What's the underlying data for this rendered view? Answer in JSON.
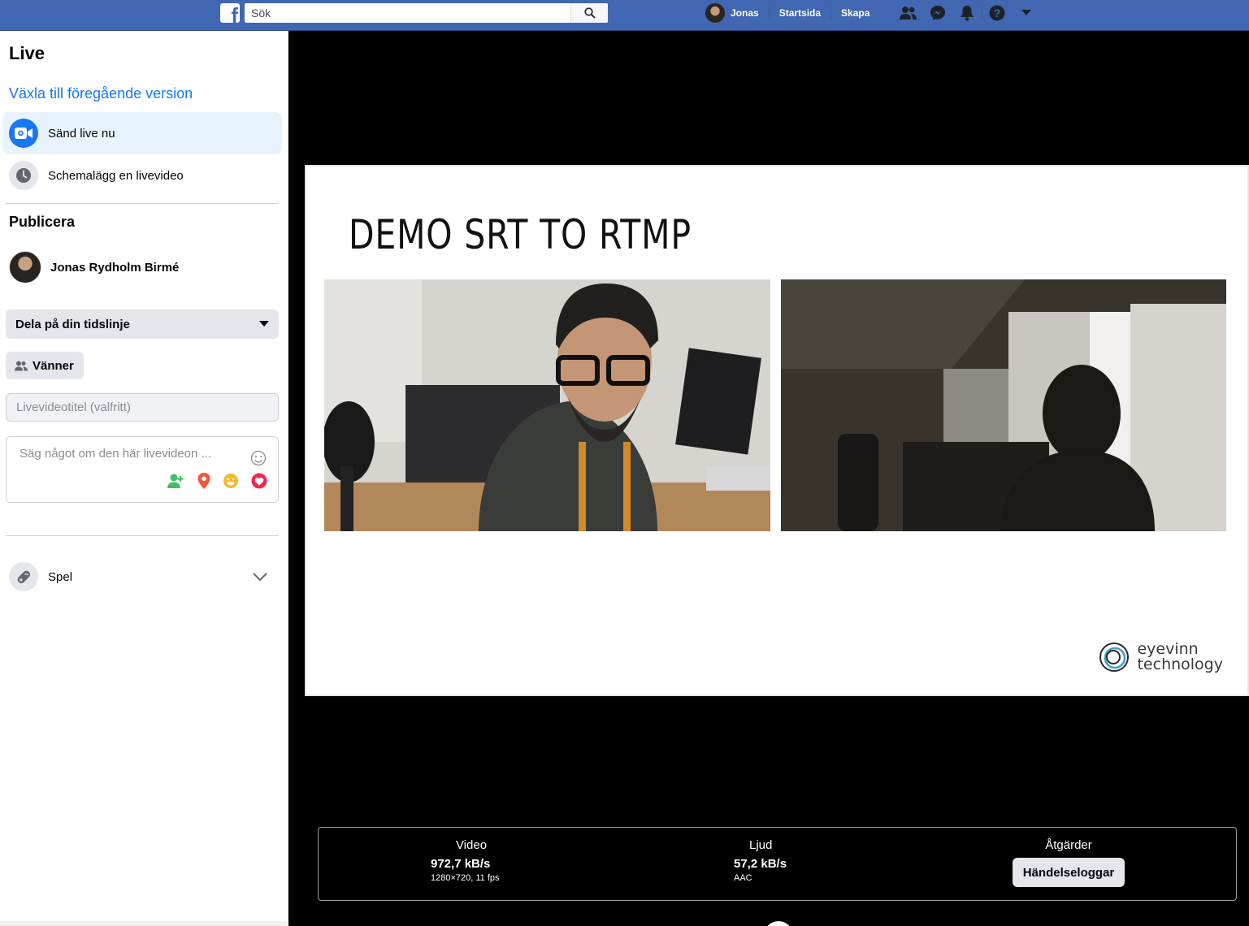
{
  "topbar": {
    "logo": "f",
    "search_placeholder": "Sök",
    "user": "Jonas",
    "links": [
      "Startsida",
      "Skapa"
    ],
    "icons": [
      "friends-icon",
      "messenger-icon",
      "notifications-icon",
      "help-icon",
      "dropdown-icon"
    ]
  },
  "sidebar": {
    "title": "Live",
    "switch_link": "Växla till föregående version",
    "items": [
      {
        "label": "Sänd live nu",
        "icon": "video-camera-icon"
      },
      {
        "label": "Schemalägg en livevideo",
        "icon": "clock-icon"
      }
    ],
    "publish_heading": "Publicera",
    "user_name": "Jonas Rydholm Birmé",
    "share_select": "Dela på din tidslinje",
    "audience_button": "Vänner",
    "title_placeholder": "Livevideotitel (valfritt)",
    "description_placeholder": "Säg något om den här livevideon ...",
    "games_label": "Spel"
  },
  "stage": {
    "slide_title": "DEMO SRT TO RTMP",
    "logo_line1": "eyevinn",
    "logo_line2": "technology"
  },
  "stats": {
    "video_label": "Video",
    "video_value": "972,7 kB/s",
    "video_detail": "1280×720, 11 fps",
    "audio_label": "Ljud",
    "audio_value": "57,2 kB/s",
    "audio_detail": "AAC",
    "actions_label": "Åtgärder",
    "event_log_button": "Händelseloggar"
  },
  "colors": {
    "topbar": "#4267b2",
    "link": "#1877f2",
    "active_bg": "#e7f3ff"
  }
}
